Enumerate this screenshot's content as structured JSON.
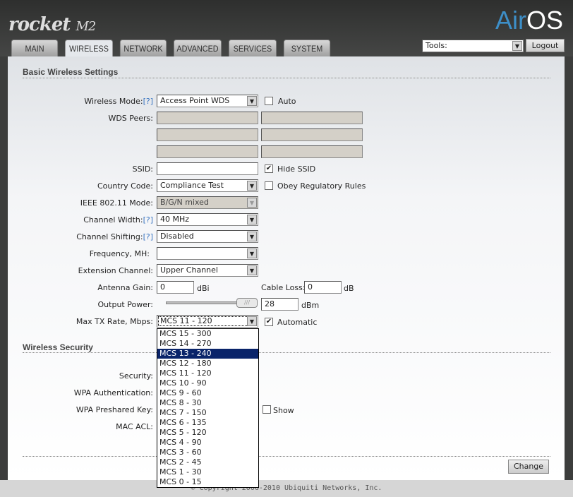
{
  "brand": {
    "product": "rocket",
    "model": "M2",
    "os_logo": "AirOS"
  },
  "tabs": [
    "MAIN",
    "WIRELESS",
    "NETWORK",
    "ADVANCED",
    "SERVICES",
    "SYSTEM"
  ],
  "tools": {
    "value": "Tools:",
    "logout": "Logout"
  },
  "basic": {
    "title": "Basic Wireless Settings",
    "help": "[?]",
    "wireless_mode": {
      "label": "Wireless Mode:",
      "value": "Access Point WDS",
      "auto_label": "Auto"
    },
    "wds_peers": {
      "label": "WDS Peers:"
    },
    "ssid": {
      "label": "SSID:",
      "value": "",
      "hide_label": "Hide SSID"
    },
    "country": {
      "label": "Country Code:",
      "value": "Compliance Test",
      "obey_label": "Obey Regulatory Rules"
    },
    "ieee_mode": {
      "label": "IEEE 802.11 Mode:",
      "value": "B/G/N mixed"
    },
    "channel_width": {
      "label": "Channel Width:",
      "value": "40 MHz"
    },
    "channel_shifting": {
      "label": "Channel Shifting:",
      "value": "Disabled"
    },
    "frequency": {
      "label": "Frequency, MH:",
      "value": ""
    },
    "extension": {
      "label": "Extension Channel:",
      "value": "Upper Channel"
    },
    "antenna_gain": {
      "label": "Antenna Gain:",
      "value": "0",
      "unit": "dBi"
    },
    "cable_loss": {
      "label": "Cable Loss:",
      "value": "0",
      "unit": "dB"
    },
    "output_power": {
      "label": "Output Power:",
      "value": "28",
      "unit": "dBm",
      "slider_fraction": 1.0
    },
    "max_tx": {
      "label": "Max TX Rate, Mbps:",
      "value": "MCS 11 - 120",
      "auto_label": "Automatic"
    }
  },
  "dropdown": {
    "options": [
      "MCS 15 - 300",
      "MCS 14 - 270",
      "MCS 13 - 240",
      "MCS 12 - 180",
      "MCS 11 - 120",
      "MCS 10 - 90",
      "MCS 9 - 60",
      "MCS 8 - 30",
      "MCS 7 - 150",
      "MCS 6 - 135",
      "MCS 5 - 120",
      "MCS 4 - 90",
      "MCS 3 - 60",
      "MCS 2 - 45",
      "MCS 1 - 30",
      "MCS 0 - 15"
    ],
    "highlighted": 2
  },
  "security": {
    "title": "Wireless Security",
    "security_label": "Security:",
    "wpa_auth_label": "WPA Authentication:",
    "wpa_key_label": "WPA Preshared Key:",
    "show_label": "Show",
    "mac_acl_label": "MAC ACL:"
  },
  "change": "Change",
  "footer": "© Copyright 2006-2010 Ubiquiti Networks, Inc."
}
